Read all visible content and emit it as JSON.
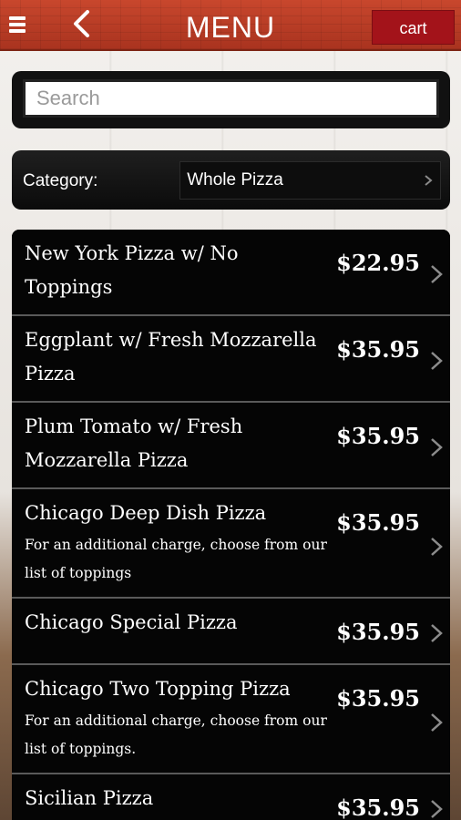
{
  "header": {
    "title": "MENU",
    "cart_label": "cart",
    "menu_icon": "hamburger-icon",
    "back_icon": "back-chevron-icon",
    "color": "#b23c25"
  },
  "search": {
    "placeholder": "Search",
    "value": ""
  },
  "category": {
    "label": "Category:",
    "selected": "Whole Pizza"
  },
  "items": [
    {
      "name": "New York Pizza w/ No Toppings",
      "description": "",
      "price": "$22.95"
    },
    {
      "name": "Eggplant w/ Fresh Mozzarella Pizza",
      "description": "",
      "price": "$35.95"
    },
    {
      "name": "Plum Tomato w/ Fresh Mozzarella Pizza",
      "description": "",
      "price": "$35.95"
    },
    {
      "name": "Chicago Deep Dish Pizza",
      "description": "For an additional charge, choose from our list of toppings",
      "price": "$35.95"
    },
    {
      "name": "Chicago Special Pizza",
      "description": "",
      "price": "$35.95"
    },
    {
      "name": "Chicago Two Topping Pizza",
      "description": "For an additional charge, choose from our list of toppings.",
      "price": "$35.95"
    },
    {
      "name": "Sicilian Pizza",
      "description": "",
      "price": "$35.95"
    }
  ]
}
